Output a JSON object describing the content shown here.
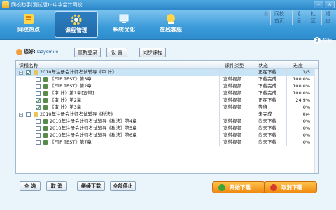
{
  "app": {
    "title": "网校助手(测试版)--中华会计网校"
  },
  "top_links": [
    "网校首页",
    "论坛",
    "社区",
    "退出"
  ],
  "nav": [
    {
      "label": "网校热点",
      "icon": "hot-news-icon"
    },
    {
      "label": "课程管理",
      "icon": "gear-icon",
      "active": true
    },
    {
      "label": "系统优化",
      "icon": "optimize-icon"
    },
    {
      "label": "在线客服",
      "icon": "customer-service-icon"
    }
  ],
  "help_label": "帮助",
  "user": {
    "greeting": "您好:",
    "name": "lazysmile"
  },
  "toolbar": {
    "relogin": "重新登录",
    "settings": "设  置",
    "sync": "同步课程"
  },
  "table": {
    "columns": [
      "课程名称",
      "课件类型",
      "状态",
      "进度"
    ],
    "rows": [
      {
        "level": 0,
        "toggle": "-",
        "checked": true,
        "name": "2010年注册会计师考试辅导《审  计》",
        "type": "",
        "status": "正在下载",
        "progress": "3/5",
        "selected": true
      },
      {
        "level": 1,
        "checked": false,
        "name": "《FTP TEST》第3章",
        "type": "宽带视频",
        "status": "下载完成",
        "progress": "100.0%"
      },
      {
        "level": 1,
        "checked": false,
        "name": "《FTP TEST》第2章",
        "type": "宽带视频",
        "status": "下载完成",
        "progress": "100.0%"
      },
      {
        "level": 1,
        "checked": false,
        "name": "《审  计》第1章[宽带]",
        "type": "宽带视频",
        "status": "下载完成",
        "progress": "100.0%"
      },
      {
        "level": 1,
        "checked": true,
        "name": "《审  计》第2章",
        "type": "宽带视频",
        "status": "正在下载",
        "progress": "24.9%"
      },
      {
        "level": 1,
        "checked": true,
        "name": "《审  计》第3章",
        "type": "宽带视频",
        "status": "等待",
        "progress": "0%"
      },
      {
        "level": 0,
        "toggle": "-",
        "checked": false,
        "name": "2010年注册会计师考试辅导《税法》",
        "type": "",
        "status": "未完成",
        "progress": "0/4"
      },
      {
        "level": 1,
        "checked": false,
        "name": "2010年注册会计师考试辅导《税法》第4章",
        "type": "宽带视频",
        "status": "尚未下载",
        "progress": "0%"
      },
      {
        "level": 1,
        "checked": false,
        "name": "2010年注册会计师考试辅导《税法》第5章",
        "type": "宽带视频",
        "status": "尚未下载",
        "progress": "0%"
      },
      {
        "level": 1,
        "checked": false,
        "name": "2010年注册会计师考试辅导《税法》第6章",
        "type": "宽带视频",
        "status": "尚未下载",
        "progress": "0%"
      },
      {
        "level": 1,
        "checked": false,
        "name": "《FTP TEST》第7章",
        "type": "宽带视频",
        "status": "尚未下载",
        "progress": "0%"
      }
    ]
  },
  "bottom": {
    "select_all": "全  选",
    "cancel": "取  消",
    "resume": "继续下载",
    "stop_all": "全部停止",
    "start_download": "开始下载",
    "cancel_download": "取消下载"
  },
  "colors": {
    "titlebar": "#2c86c8",
    "navbar": "#3a9ad8",
    "accent_orange": "#f08a12",
    "selection": "#c9e4f7"
  }
}
